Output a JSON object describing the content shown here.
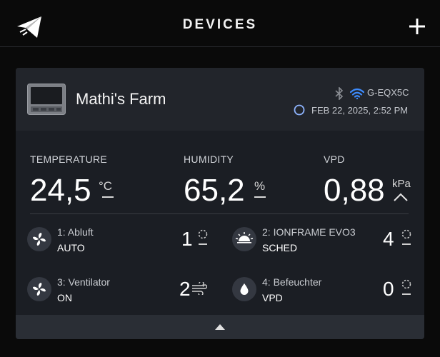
{
  "header": {
    "title": "DEVICES",
    "logo_icon": "paper-plane-logo-icon",
    "add_icon": "plus-icon"
  },
  "device": {
    "name": "Mathi's Farm",
    "id": "G-EQX5C",
    "timestamp": "FEB 22, 2025, 2:52 PM",
    "bluetooth_icon": "bluetooth-icon",
    "wifi_icon": "wifi-icon",
    "wifi_color": "#3d8bfd",
    "clock_icon": "clock-icon",
    "clock_color": "#8eb4ff"
  },
  "metrics": [
    {
      "label": "TEMPERATURE",
      "value": "24,5",
      "unit": "°C"
    },
    {
      "label": "HUMIDITY",
      "value": "65,2",
      "unit": "%"
    },
    {
      "label": "VPD",
      "value": "0,88",
      "unit": "kPa"
    }
  ],
  "ports": [
    {
      "name": "1: Abluft",
      "mode": "AUTO",
      "level": "1",
      "icon": "fan-icon",
      "status_icon": "timer-icon"
    },
    {
      "name": "2: IONFRAME EVO3",
      "mode": "SCHED",
      "level": "4",
      "icon": "grow-light-icon",
      "status_icon": "timer-icon"
    },
    {
      "name": "3: Ventilator",
      "mode": "ON",
      "level": "2",
      "icon": "fan-icon",
      "status_icon": "wind-icon"
    },
    {
      "name": "4: Befeuchter",
      "mode": "VPD",
      "level": "0",
      "icon": "water-drop-icon",
      "status_icon": "timer-icon"
    }
  ],
  "colors": {
    "background": "#0a0a0a",
    "card": "#1b1e24",
    "card_header": "#22252b"
  }
}
